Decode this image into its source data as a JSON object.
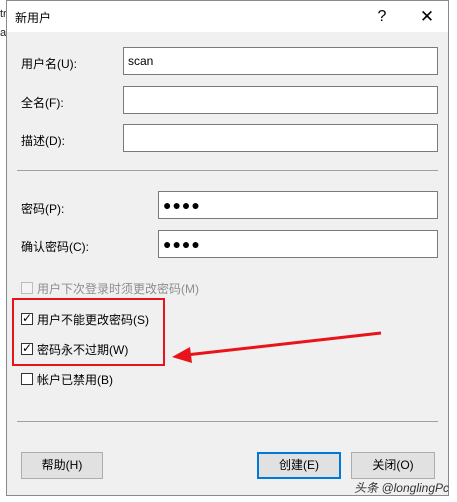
{
  "background_fragments": [
    "tr",
    "ac"
  ],
  "window": {
    "title": "新用户",
    "help_glyph": "?",
    "close_glyph": "✕"
  },
  "fields": {
    "username": {
      "label": "用户名(U):",
      "value": "scan"
    },
    "fullname": {
      "label": "全名(F):",
      "value": ""
    },
    "description": {
      "label": "描述(D):",
      "value": ""
    },
    "password": {
      "label": "密码(P):",
      "value": "●●●●"
    },
    "confirm": {
      "label": "确认密码(C):",
      "value": "●●●●"
    }
  },
  "checkboxes": [
    {
      "label": "用户下次登录时须更改密码(M)",
      "checked": false,
      "disabled": true
    },
    {
      "label": "用户不能更改密码(S)",
      "checked": true,
      "disabled": false
    },
    {
      "label": "密码永不过期(W)",
      "checked": true,
      "disabled": false
    },
    {
      "label": "帐户已禁用(B)",
      "checked": false,
      "disabled": false
    }
  ],
  "buttons": {
    "help": "帮助(H)",
    "create": "创建(E)",
    "close": "关闭(O)"
  },
  "annotation": {
    "box_color": "#e8141a",
    "arrow_color": "#e8141a"
  },
  "watermark": "头条 @longlingPc"
}
